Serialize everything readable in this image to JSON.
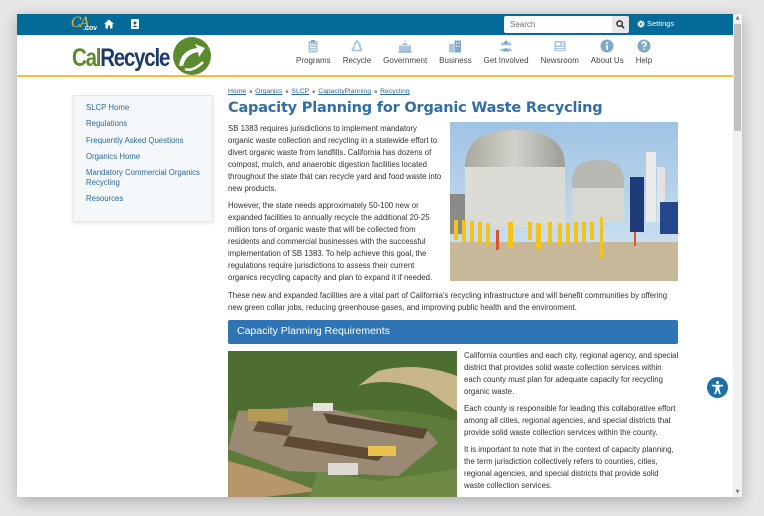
{
  "utility": {
    "ca_logo": "CA",
    "ca_gov": ".GOV",
    "search_placeholder": "Search",
    "settings_label": "Settings",
    "icons": [
      "home-icon",
      "contact-icon",
      "search-icon",
      "gear-icon"
    ]
  },
  "branding": {
    "logo_cal": "Cal",
    "logo_recycle": "Recycle",
    "colors": {
      "brand_blue": "#046b99",
      "brand_green": "#5b8a2f",
      "navy": "#1c3a6b",
      "gold": "#f3c02e",
      "accent": "#2f75b5"
    }
  },
  "nav": [
    {
      "label": "Programs",
      "icon": "clipboard-icon"
    },
    {
      "label": "Recycle",
      "icon": "recycle-icon"
    },
    {
      "label": "Government",
      "icon": "capitol-icon"
    },
    {
      "label": "Business",
      "icon": "buildings-icon"
    },
    {
      "label": "Get Involved",
      "icon": "people-icon"
    },
    {
      "label": "Newsroom",
      "icon": "newspaper-icon"
    },
    {
      "label": "About Us",
      "icon": "info-icon"
    },
    {
      "label": "Help",
      "icon": "question-icon"
    }
  ],
  "sidebar": {
    "items": [
      {
        "label": "SLCP Home"
      },
      {
        "label": "Regulations"
      },
      {
        "label": "Frequently Asked Questions"
      },
      {
        "label": "Organics Home"
      },
      {
        "label": "Mandatory Commercial Organics Recycling"
      },
      {
        "label": "Resources"
      }
    ]
  },
  "breadcrumb": [
    "Home",
    "Organics",
    "SLCP",
    "CapacityPlanning",
    "Recycling"
  ],
  "page": {
    "title": "Capacity Planning for Organic Waste Recycling",
    "intro_paragraphs": [
      "SB 1383 requires jurisdictions to implement mandatory organic waste collection and recycling in a statewide effort to divert organic waste from landfills. California has dozens of compost, mulch, and anaerobic digestion facilities located throughout the state that can recycle yard and food waste into new products.",
      "However, the state needs approximately 50-100 new or expanded facilities to annually recycle the additional 20-25 million tons of organic waste that will be collected from residents and commercial businesses with the successful implementation of SB 1383. To help achieve this goal, the regulations require jurisdictions to assess their current organics recycling capacity and plan to expand it if needed."
    ],
    "full_paragraph": "These new and expanded facilities are a vital part of California's recycling infrastructure and will benefit communities by offering new green collar jobs, reducing greenhouse gases, and improving public health and the environment.",
    "section_heading": "Capacity Planning Requirements",
    "requirement_paragraphs": [
      "California counties and each city, regional agency, and special district that provides solid waste collection services within each county must plan for adequate capacity for recycling organic waste.",
      "Each county is responsible for leading this collaborative effort among all cities, regional agencies, and special districts that provide solid waste collection services within the county.",
      "It is important to note that in the context of capacity planning, the term jurisdiction collectively refers to counties, cities, regional agencies, and special districts that provide solid waste collection services."
    ],
    "images": [
      {
        "description": "anaerobic digester domes with yellow bollards"
      },
      {
        "description": "aerial view of compost facility in hills"
      }
    ]
  },
  "accessibility": {
    "icon": "accessibility-icon"
  }
}
